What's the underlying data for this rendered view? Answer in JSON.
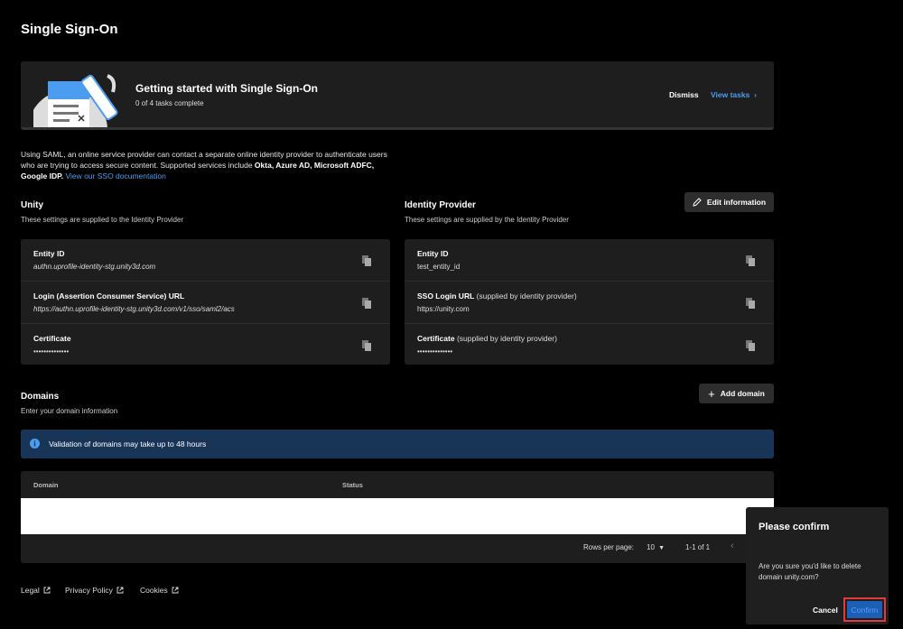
{
  "page": {
    "title": "Single Sign-On"
  },
  "banner": {
    "title": "Getting started with Single Sign-On",
    "subtitle": "0 of 4 tasks complete",
    "dismiss_label": "Dismiss",
    "view_tasks_label": "View tasks"
  },
  "intro": {
    "text": "Using SAML, an online service provider can contact a separate online identity provider to authenticate users who are trying to access secure content. Supported services include ",
    "bold_services": "Okta, Azure AD, Microsoft ADFC, Google IDP.",
    "doc_link": "View our SSO documentation"
  },
  "unity": {
    "title": "Unity",
    "subtitle": "These settings are supplied to the Identity Provider",
    "rows": [
      {
        "label": "Entity ID",
        "value": "authn.uprofile-identity-stg.unity3d.com"
      },
      {
        "label": "Login (Assertion Consumer Service) URL",
        "value": "https://authn.uprofile-identity-stg.unity3d.com/v1/sso/saml2/acs"
      },
      {
        "label": "Certificate",
        "value": "••••••••••••••"
      }
    ]
  },
  "idp": {
    "title": "Identity Provider",
    "subtitle": "These settings are supplied by the Identity Provider",
    "edit_label": "Edit information",
    "rows": [
      {
        "label": "Entity ID",
        "note": "",
        "value": "test_entity_id"
      },
      {
        "label": "SSO Login URL",
        "note": " (supplied by identity provider)",
        "value": "https://unity.com"
      },
      {
        "label": "Certificate",
        "note": " (supplied by identity provider)",
        "value": "••••••••••••••"
      }
    ]
  },
  "domains": {
    "title": "Domains",
    "subtitle": "Enter your domain information",
    "add_label": "Add domain",
    "info": "Validation of domains may take up to 48 hours",
    "columns": [
      "Domain",
      "Status"
    ],
    "rows_per_page_label": "Rows per page:",
    "rows_per_page_value": "10",
    "range": "1-1 of 1"
  },
  "footer": {
    "legal": "Legal",
    "privacy": "Privacy Policy",
    "cookies": "Cookies"
  },
  "confirm_dialog": {
    "title": "Please confirm",
    "message": "Are you sure you'd like to delete domain unity.com?",
    "cancel_label": "Cancel",
    "confirm_label": "Confirm"
  },
  "colors": {
    "link": "#4c9cf0",
    "info_bg": "#183558",
    "confirm_bg": "#1d5fb4",
    "highlight": "#e23b3b"
  }
}
